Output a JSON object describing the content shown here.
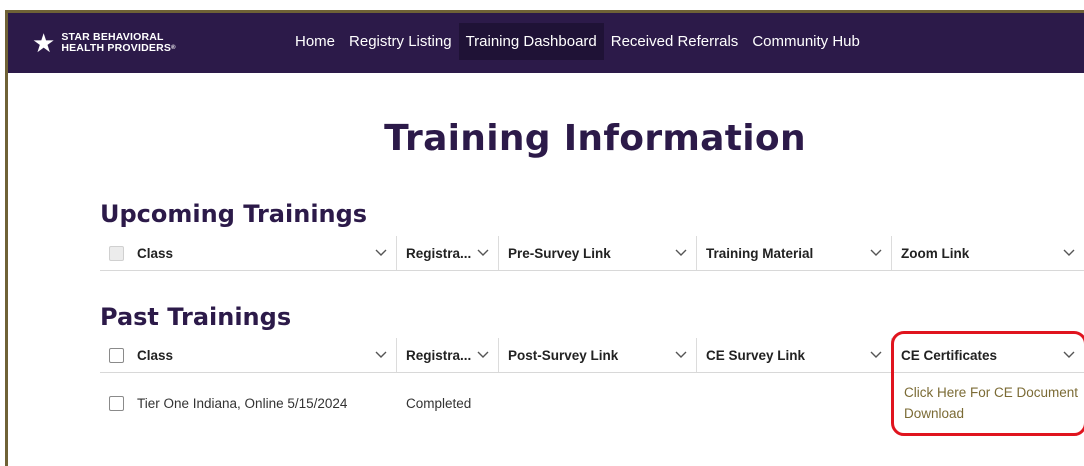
{
  "brand": {
    "line1": "STAR BEHAVIORAL",
    "line2": "HEALTH PROVIDERS",
    "reg": "®"
  },
  "nav": [
    {
      "label": "Home"
    },
    {
      "label": "Registry Listing"
    },
    {
      "label": "Training Dashboard",
      "active": true
    },
    {
      "label": "Received Referrals"
    },
    {
      "label": "Community Hub"
    }
  ],
  "page_title": "Training Information",
  "upcoming": {
    "title": "Upcoming Trainings",
    "columns": [
      "Class",
      "Registra...",
      "Pre-Survey Link",
      "Training Material",
      "Zoom Link"
    ]
  },
  "past": {
    "title": "Past Trainings",
    "columns": [
      "Class",
      "Registra...",
      "Post-Survey Link",
      "CE Survey Link",
      "CE Certificates"
    ],
    "rows": [
      {
        "class": "Tier One Indiana, Online 5/15/2024",
        "registration": "Completed",
        "ce_link": "Click Here For CE Document Download"
      }
    ]
  },
  "colors": {
    "nav_bg": "#2c1a49",
    "title": "#2c1a49",
    "link": "#7b6b35",
    "highlight": "#e0141e"
  }
}
